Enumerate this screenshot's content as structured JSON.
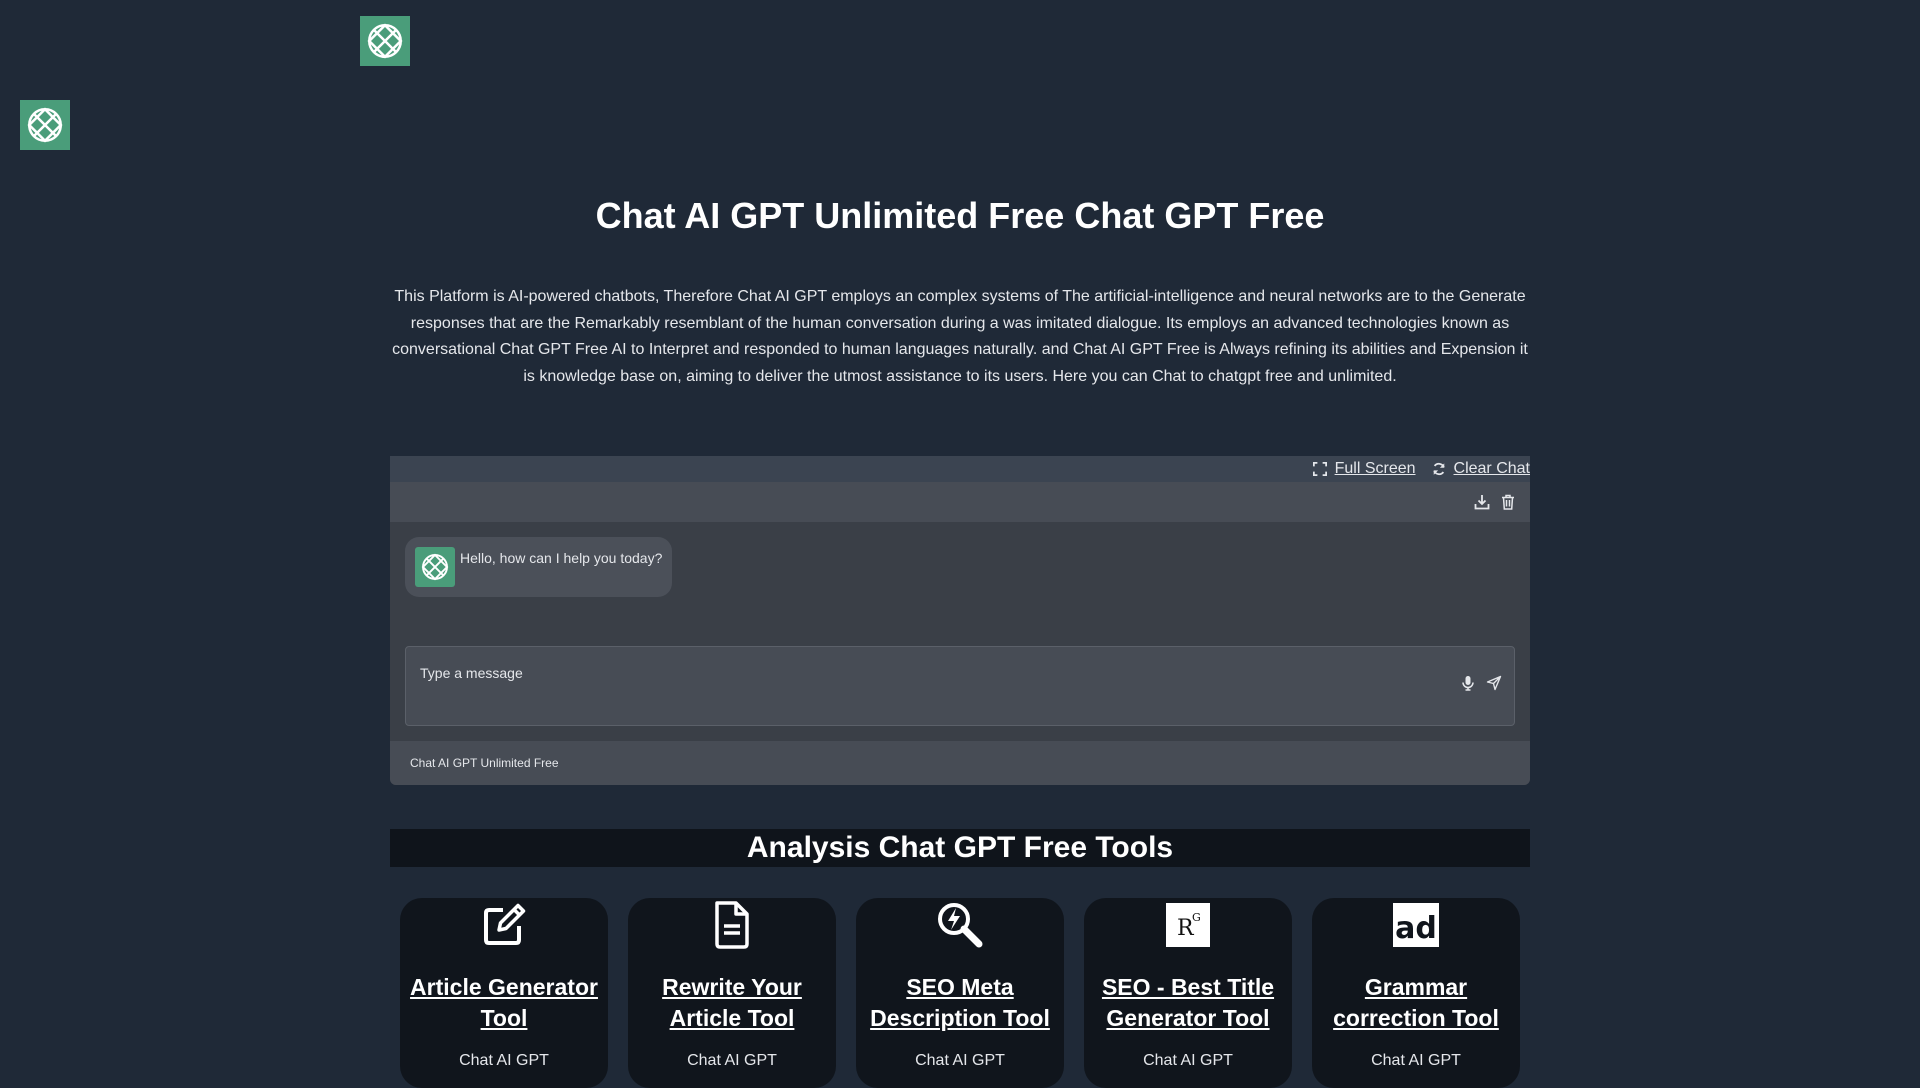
{
  "logos": {
    "top": "chatgpt-logo",
    "left": "chatgpt-logo"
  },
  "page": {
    "title": "Chat AI GPT Unlimited Free Chat GPT Free",
    "intro": "This Platform is AI-powered chatbots, Therefore Chat AI GPT employs an complex systems of The artificial-intelligence and neural networks are to the Generate responses that are the Remarkably resemblant of the human conversation during a was imitated dialogue. Its employs an advanced technologies known as conversational Chat GPT Free AI to Interpret and responded to human languages naturally. and Chat AI GPT Free is Always refining its abilities and Expension it is knowledge base on, aiming to deliver the utmost assistance to its users. Here you can Chat to chatgpt free and unlimited."
  },
  "chat": {
    "full_screen_label": "Full Screen",
    "clear_chat_label": "Clear Chat",
    "greeting": "Hello, how can I help you today?",
    "input_placeholder": "Type a message",
    "footer": "Chat AI GPT Unlimited Free"
  },
  "tools": {
    "heading": "Analysis Chat GPT Free Tools",
    "items": [
      {
        "title": "Article Generator Tool",
        "subtitle": "Chat AI GPT",
        "icon": "edit-icon"
      },
      {
        "title": "Rewrite Your Article Tool",
        "subtitle": "Chat AI GPT",
        "icon": "document-icon"
      },
      {
        "title": "SEO Meta Description Tool",
        "subtitle": "Chat AI GPT",
        "icon": "search-bolt-icon"
      },
      {
        "title": "SEO - Best Title Generator Tool",
        "subtitle": "Chat AI GPT",
        "icon": "researchgate-icon",
        "icon_text": "R"
      },
      {
        "title": "Grammar correction Tool",
        "subtitle": "Chat AI GPT",
        "icon": "ad-icon",
        "icon_text": "ad"
      }
    ]
  },
  "colors": {
    "background": "#1f2937",
    "accent": "#4a9d7a",
    "card": "#10151c"
  }
}
